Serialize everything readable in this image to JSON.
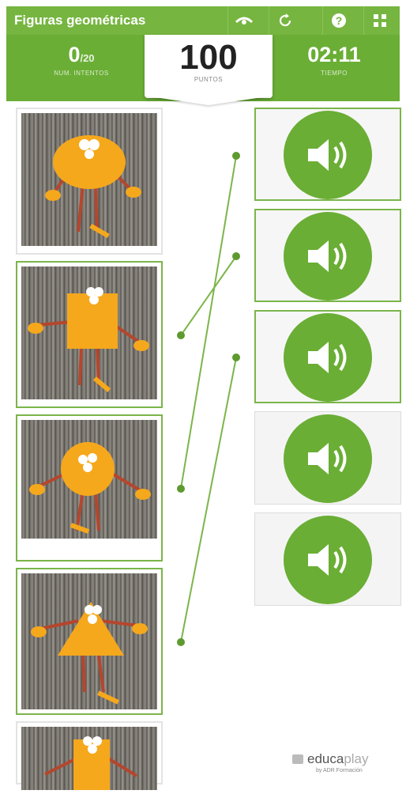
{
  "app": {
    "title": "Figuras geométricas"
  },
  "toolbar": {
    "icons": [
      "eye-icon",
      "restart-icon",
      "help-icon",
      "fullscreen-icon"
    ]
  },
  "stats": {
    "attempts_value": "0",
    "attempts_total": "/20",
    "attempts_label": "NUM. INTENTOS",
    "score_value": "100",
    "score_label": "PUNTOS",
    "time_value": "02:11",
    "time_label": "TIEMPO"
  },
  "image_cards": [
    {
      "shape": "oval",
      "linked": false
    },
    {
      "shape": "square",
      "linked": true
    },
    {
      "shape": "circle",
      "linked": true
    },
    {
      "shape": "triangle",
      "linked": true
    },
    {
      "shape": "rectangle",
      "linked": false
    }
  ],
  "sound_cards": [
    {
      "icon": "speaker-icon",
      "linked": true
    },
    {
      "icon": "speaker-icon",
      "linked": true
    },
    {
      "icon": "speaker-icon",
      "linked": true
    },
    {
      "icon": "speaker-icon",
      "linked": false
    },
    {
      "icon": "speaker-icon",
      "linked": false
    }
  ],
  "colors": {
    "brand_green": "#76b540",
    "stats_green": "#6aae35",
    "shape_orange": "#f5a81c"
  },
  "branding": {
    "logo_text_a": "educa",
    "logo_text_b": "play",
    "logo_sub": "by ADR Formación"
  }
}
